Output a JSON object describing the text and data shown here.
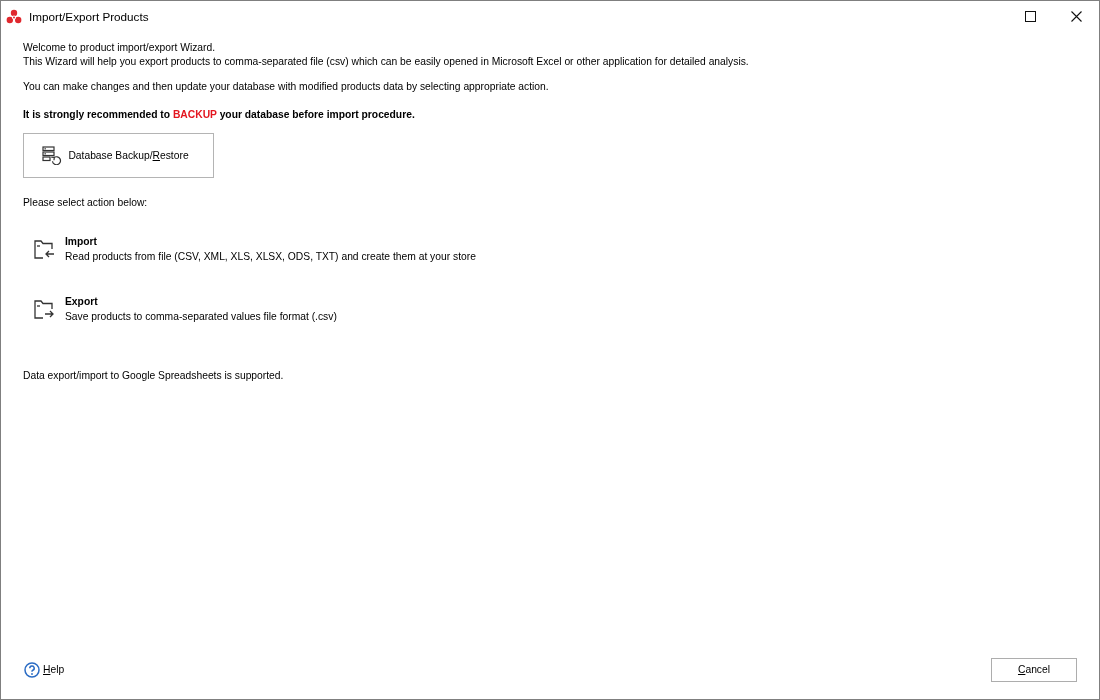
{
  "window": {
    "title": "Import/Export Products"
  },
  "intro": [
    "Welcome to product import/export Wizard.",
    "This Wizard will help you export products to comma-separated file (csv) which can be easily opened in Microsoft Excel or other application for detailed analysis."
  ],
  "note": "You can make changes and then update your database with modified products data by selecting appropriate action.",
  "warning": {
    "before": "It is strongly recommended to ",
    "highlight": "BACKUP",
    "after": " your database before import procedure."
  },
  "backup_button": {
    "label": [
      {
        "text": "Database Backup/",
        "underlined": false
      },
      {
        "text": "R",
        "underlined": true
      },
      {
        "text": "estore",
        "underlined": false
      }
    ]
  },
  "prompt": "Please select action below:",
  "actions": [
    {
      "kind": "import",
      "title": "Import",
      "description": "Read products from file (CSV, XML, XLS, XLSX, ODS, TXT) and create them at your store"
    },
    {
      "kind": "export",
      "title": "Export",
      "description": "Save products to comma-separated values file format (.csv)"
    }
  ],
  "footnote": "Data export/import to Google Spreadsheets is supported.",
  "help": {
    "label": [
      {
        "text": "H",
        "underlined": true
      },
      {
        "text": "elp",
        "underlined": false
      }
    ]
  },
  "cancel_button": {
    "label": [
      {
        "text": "C",
        "underlined": true
      },
      {
        "text": "ancel",
        "underlined": false
      }
    ]
  }
}
